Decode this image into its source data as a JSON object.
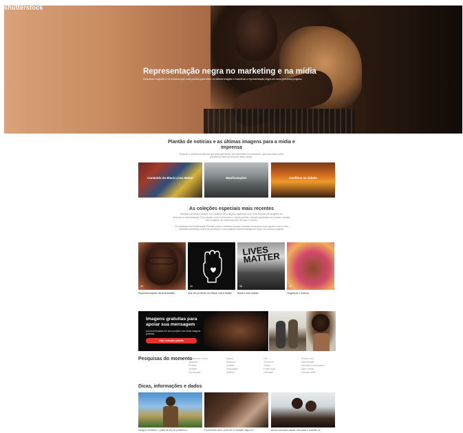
{
  "brand": {
    "logo_text": "shutterstock"
  },
  "hero": {
    "title": "Representação negra no marketing e na mídia",
    "subtitle": "Descubra o suporte e os recursos que você precisa para obter os últimos insights e incentivar a representação negra em seus próximos projetos."
  },
  "news": {
    "title_line1": "Plantão de notícias e as últimas imagens para a mídia e",
    "title_line2": "imprensa",
    "desc_line1": "Explore a cobertura editorial que está ganhando as manchetes no momento. Aprenda mais sobre",
    "desc_line2": "jornalismo para as marcas nesta seção.",
    "cards": [
      {
        "label": "Conteúdo do Black Lives Matter"
      },
      {
        "label": "Manifestações"
      },
      {
        "label": "Conflitos na cidade"
      }
    ]
  },
  "collections": {
    "title": "As coleções especiais mais recentes",
    "desc_line1": "Nossos curadores criaram um conjunto de coleções especiais com uma seleção de imagens de",
    "desc_line2": "pessoas e comunidades. Para ajudar você a encontrar o visual perfeito, sempre atualizamos a nossa coleção",
    "desc_line3": "com imagens de colaboradores de todo o mundo.",
    "desc_line4": "Os criadores da Shutterstock Premier podem acessar nossas coleções exclusivas para ajudar você a criar",
    "desc_line5": "histórias autênticas sobre as pessoas e comunidades representadas em todos os nossos projetos.",
    "cards": [
      {
        "caption": "Representações da diversidade",
        "badge": "30"
      },
      {
        "caption": "Arte de protesto do Black Lives Matter",
        "badge": "49"
      },
      {
        "caption": "Black Lives Matter",
        "badge": "38"
      },
      {
        "caption": "Negritude e beleza",
        "badge": "25"
      }
    ],
    "sign_text_1": "LIVES",
    "sign_text_2": "MATTER"
  },
  "promo": {
    "title": "Imagens gratuitas para apoiar sua mensagem",
    "desc": "Inclua diversidade em seus projetos com estas imagens gratuitas.",
    "button": "Veja a coleção gratuita"
  },
  "trending": {
    "title": "Pesquisas do momento",
    "columns": [
      [
        "Movimentos Sociais",
        "Igualdade",
        "Protesto",
        "Verdade",
        "Comunidade"
      ],
      [
        "Negros",
        "Racismo",
        "Unidade",
        "Diversidade",
        "Ativismo"
      ],
      [
        "Paz",
        "Juventude",
        "Justiça",
        "Poder negro",
        "Liberdade"
      ],
      [
        "Direitos civis",
        "Manifestação",
        "Movimento antirracismo",
        "Mãos unidas",
        "Inclusão racial"
      ]
    ]
  },
  "tips": {
    "title": "Dicas, informações e dados",
    "cards": [
      {
        "caption": "Designer mulheres: o papel da arte de protesto no..."
      },
      {
        "caption": "Promovendo valor: como ver a inovação negra no..."
      },
      {
        "caption": "Novos conteúdos visuais: bem-estar e conexão na..."
      }
    ]
  },
  "colors": {
    "accent": "#e8322a",
    "dark": "#0a0a0a"
  }
}
